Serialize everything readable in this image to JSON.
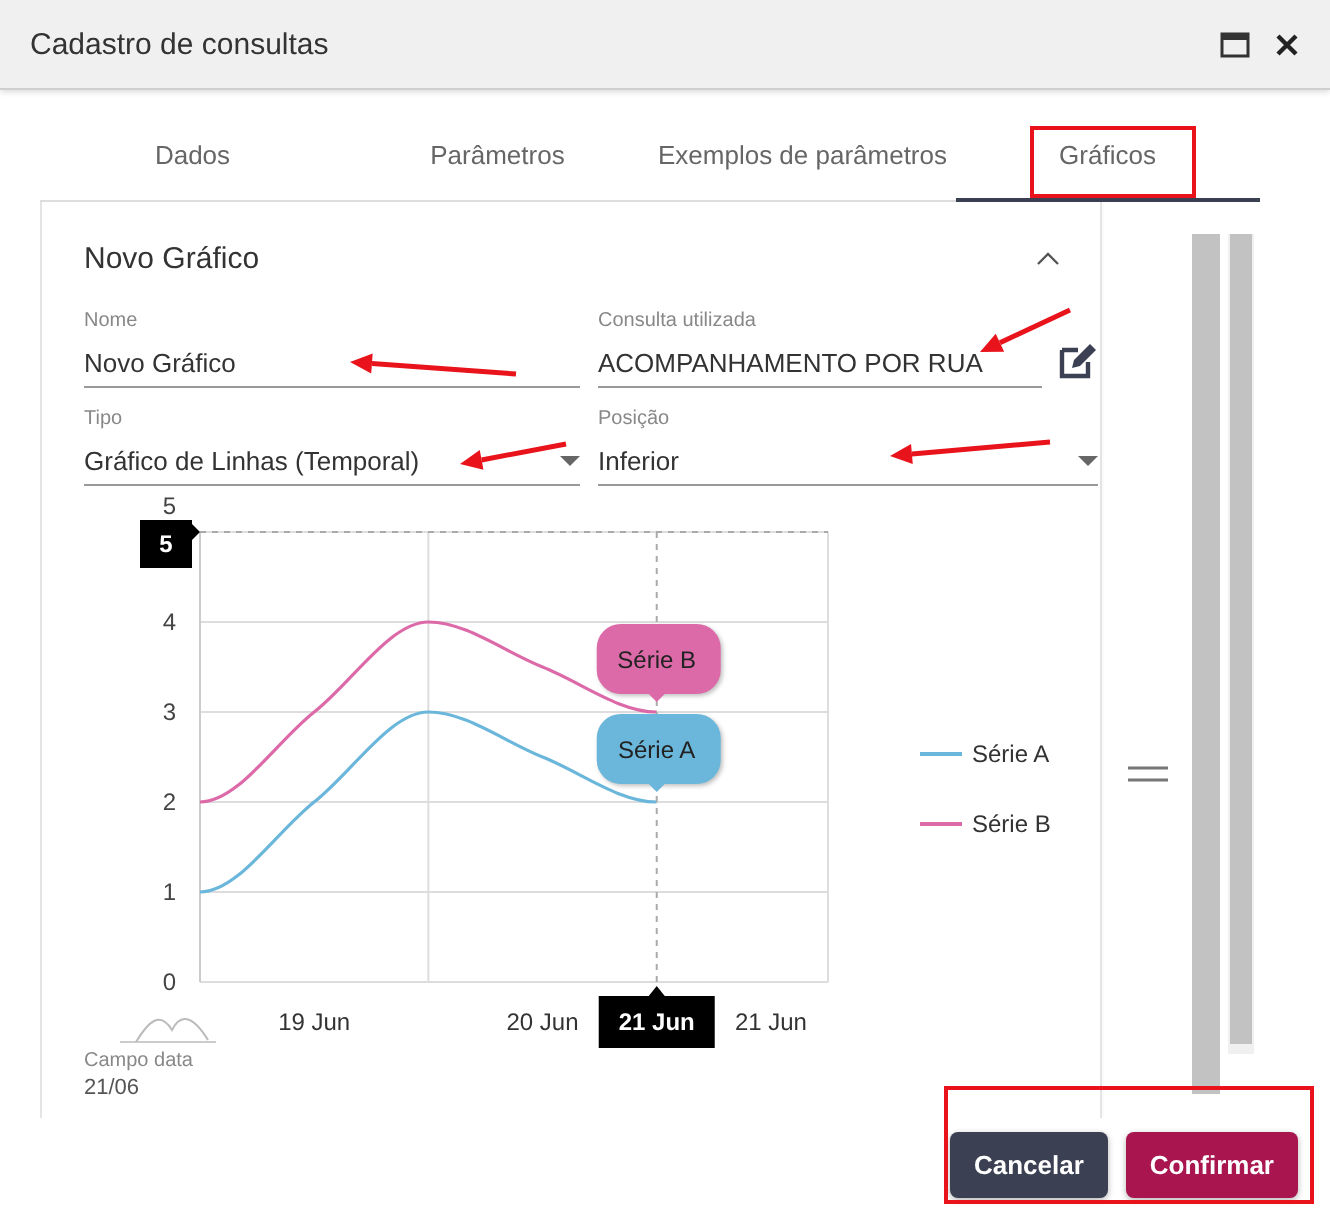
{
  "window": {
    "title": "Cadastro de consultas"
  },
  "tabs": [
    {
      "label": "Dados",
      "selected": false
    },
    {
      "label": "Parâmetros",
      "selected": false
    },
    {
      "label": "Exemplos de parâmetros",
      "selected": false
    },
    {
      "label": "Gráficos",
      "selected": true
    }
  ],
  "panel": {
    "title": "Novo Gráfico",
    "expanded": true,
    "fields": [
      {
        "kind": "text",
        "label": "Nome",
        "value": "Novo Gráfico"
      },
      {
        "kind": "edit",
        "label": "Consulta utilizada",
        "value": "ACOMPANHAMENTO POR RUA"
      },
      {
        "kind": "select",
        "label": "Tipo",
        "value": "Gráfico de Linhas (Temporal)"
      },
      {
        "kind": "select",
        "label": "Posição",
        "value": "Inferior"
      }
    ],
    "chart_data": {
      "type": "line",
      "categories": [
        null,
        "19 Jun",
        null,
        "20 Jun",
        null,
        "21 Jun"
      ],
      "ylim": [
        0,
        5
      ],
      "yticks": [
        0,
        1,
        2,
        3,
        4,
        5
      ],
      "grid": true,
      "legend": true,
      "series": [
        {
          "name": "Série A",
          "color": "#6bb7db",
          "values": [
            1,
            2,
            3,
            2.5,
            2,
            null
          ]
        },
        {
          "name": "Série B",
          "color": "#dd6aa8",
          "values": [
            2,
            3,
            4,
            3.5,
            3,
            null
          ]
        }
      ],
      "ref_lines": [
        {
          "axis": "y",
          "value": 5,
          "label": "5"
        }
      ]
    },
    "chart_overlays": {
      "crosshair_label": "21 Jun",
      "tooltips": [
        {
          "label": "Série B"
        },
        {
          "label": "Série A"
        }
      ]
    },
    "date_field": {
      "label": "Campo data",
      "value": "21/06"
    }
  },
  "buttons": [
    {
      "label": "Cancelar",
      "kind": "secondary"
    },
    {
      "label": "Confirmar",
      "kind": "primary"
    }
  ]
}
